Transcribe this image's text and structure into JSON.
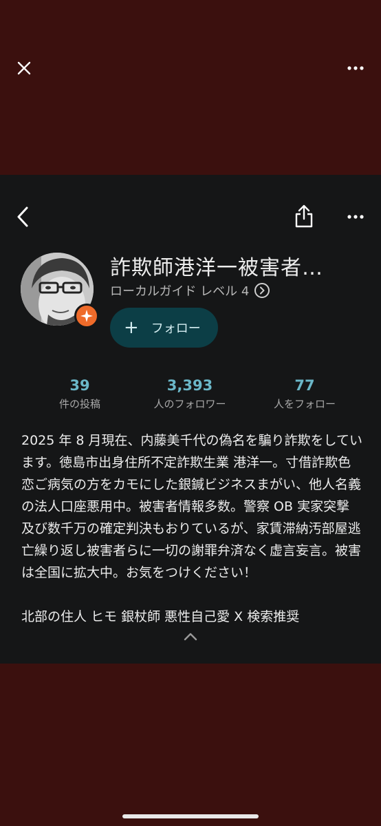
{
  "profile": {
    "name": "詐欺師港洋一被害者…",
    "guide_label": "ローカルガイド レベル 4",
    "follow_label": "フォロー",
    "follow_plus": "+"
  },
  "stats": [
    {
      "value": "39",
      "label": "件の投稿"
    },
    {
      "value": "3,393",
      "label": "人のフォロワー"
    },
    {
      "value": "77",
      "label": "人をフォロー"
    }
  ],
  "bio": {
    "text": "2025 年 8 月現在、内藤美千代の偽名を騙り詐欺をしています。徳島市出身住所不定詐欺生業 港洋一。寸借詐欺色恋ご病気の方をカモにした銀鍼ビジネスまがい、他人名義の法人口座悪用中。被害者情報多数。警察 OB 実家突撃及び数千万の確定判決もおりているが、家賃滞納汚部屋逃亡繰り返し被害者らに一切の謝罪弁済なく虚言妄言。被害は全国に拡大中。お気をつけください！",
    "tags": "北部の住人 ヒモ 銀杖師 悪性自己愛 X 検索推奨"
  },
  "colors": {
    "background": "#3b100e",
    "sheet": "#151617",
    "accent": "#6bb7c8",
    "follow_button": "#0c3e46",
    "badge": "#ef6b2a"
  },
  "icons": {
    "close": "close-icon",
    "more": "more-horizontal-icon",
    "back": "chevron-left-icon",
    "share": "share-icon",
    "badge": "sparkle-icon",
    "guide_chevron": "chevron-right-circle-icon",
    "collapse": "chevron-up-icon"
  }
}
